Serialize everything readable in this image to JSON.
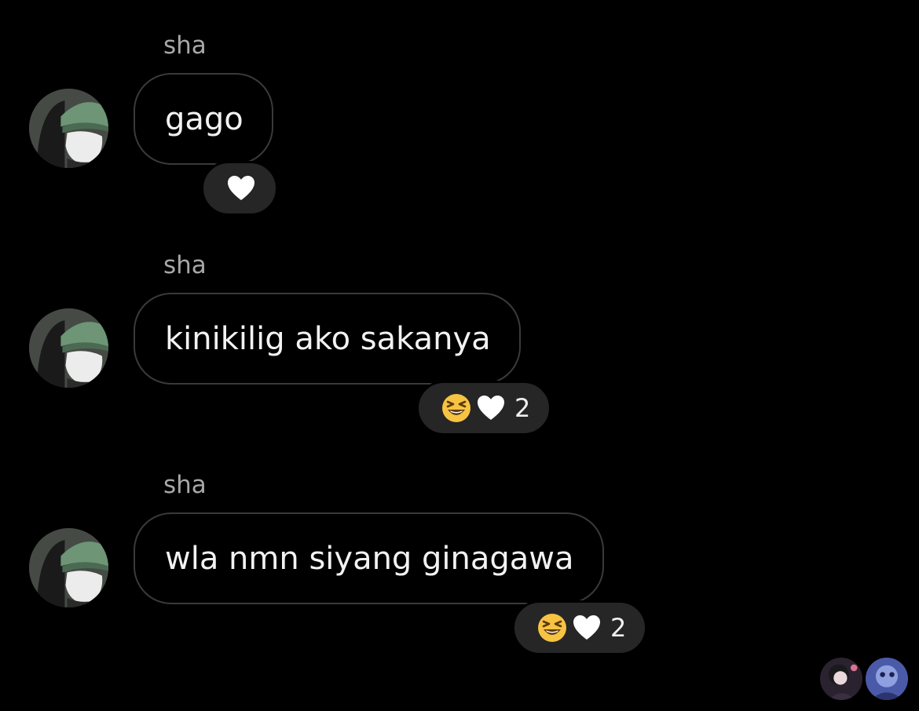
{
  "messages": [
    {
      "sender": "sha",
      "text": "gago",
      "reactions": [
        "white-heart"
      ],
      "count": ""
    },
    {
      "sender": "sha",
      "text": "kinikilig ako sakanya",
      "reactions": [
        "laughing-face",
        "white-heart"
      ],
      "count": "2"
    },
    {
      "sender": "sha",
      "text": "wla nmn siyang ginagawa",
      "reactions": [
        "laughing-face",
        "white-heart"
      ],
      "count": "2"
    }
  ],
  "seen_by": [
    "seen-avatar-1",
    "seen-avatar-2"
  ],
  "colors": {
    "background": "#000000",
    "bubble_border": "#3a3a3a",
    "reaction_pill": "#262626",
    "sender_text": "#a8a8a8",
    "message_text": "#f2f2f2"
  }
}
